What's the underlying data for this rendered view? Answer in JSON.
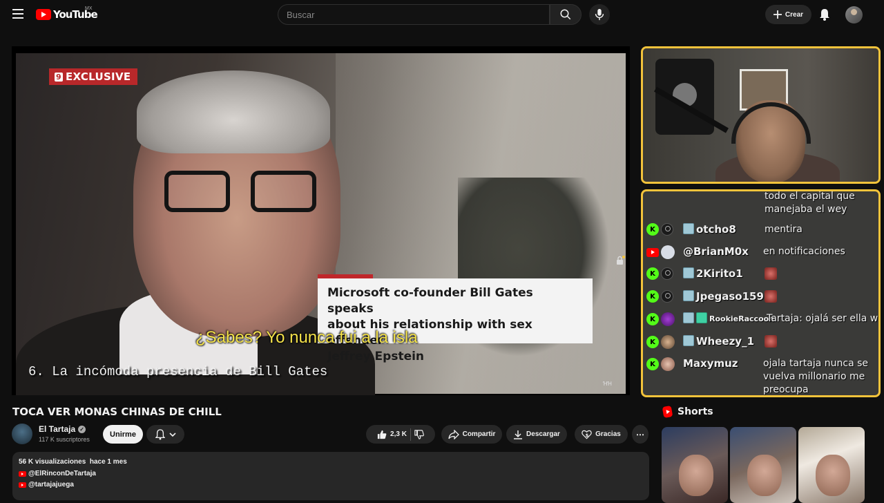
{
  "header": {
    "logo_text": "YouTube",
    "country_code": "MX",
    "search_placeholder": "Buscar",
    "create_label": "Crear"
  },
  "player": {
    "exclusive_tag": "EXCLUSIVE",
    "exclusive_num": "9",
    "caption_lines": [
      "Microsoft co-founder Bill Gates speaks",
      "about his relationship with sex offender",
      "Jeffrey Epstein"
    ],
    "subtitle": "¿Sabes? Yo nunca fui a la isla",
    "overlay_title": "6. La incómoda presencia de Bill Gates",
    "watermark": "ꞪꞪ"
  },
  "chat": {
    "top_message": [
      "todo el capital que",
      "manejaba el wey"
    ],
    "messages": [
      {
        "platform": "kick",
        "user": "otcho8",
        "message": "mentira",
        "emote": false
      },
      {
        "platform": "youtube",
        "user": "@BrianM0x",
        "message": "en notificaciones",
        "emote": false
      },
      {
        "platform": "kick",
        "user": "2Kirito1",
        "message": "",
        "emote": true
      },
      {
        "platform": "kick",
        "user": "Jpegaso159",
        "message": "",
        "emote": true
      },
      {
        "platform": "kick",
        "user": "RookieRaccoon",
        "message": "Tartaja: ojalá ser ella we",
        "emote": false
      },
      {
        "platform": "kick",
        "user": "Wheezy_1",
        "message": "",
        "emote": true
      },
      {
        "platform": "kick",
        "user": "Maxymuz",
        "message": "ojala tartaja nunca se vuelva millonario me preocupa",
        "emote": false
      }
    ]
  },
  "video": {
    "title": "TOCA VER MONAS CHINAS DE CHILL",
    "channel_name": "El Tartaja",
    "subscribers": "117 K suscriptores",
    "join_label": "Unirme",
    "likes": "2,3 K",
    "share_label": "Compartir",
    "download_label": "Descargar",
    "thanks_label": "Gracias"
  },
  "description": {
    "views": "56 K visualizaciones",
    "date": "hace 1 mes",
    "links": [
      "@ElRinconDeTartaja",
      "@tartajajuega"
    ]
  },
  "shorts": {
    "label": "Shorts"
  },
  "colors": {
    "accent_frame": "#f3c33b",
    "kick_green": "#53fc18",
    "youtube_red": "#ff0000"
  }
}
